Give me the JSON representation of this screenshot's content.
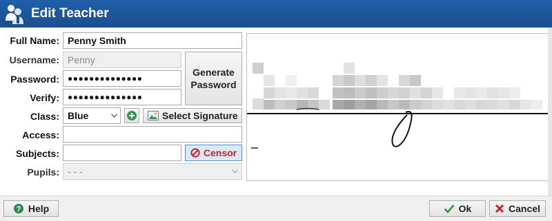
{
  "window": {
    "title": "Edit Teacher"
  },
  "form": {
    "full_name": {
      "label": "Full Name:",
      "value": "Penny Smith"
    },
    "username": {
      "label": "Username:",
      "value": "Penny"
    },
    "password": {
      "label": "Password:",
      "value": "●●●●●●●●●●●●●●"
    },
    "verify": {
      "label": "Verify:",
      "value": "●●●●●●●●●●●●●●"
    },
    "generate_password": {
      "line1": "Generate",
      "line2": "Password"
    },
    "class": {
      "label": "Class:",
      "value": "Blue"
    },
    "select_signature": {
      "label": "Select Signature"
    },
    "access": {
      "label": "Access:",
      "value": ""
    },
    "subjects": {
      "label": "Subjects:",
      "value": ""
    },
    "censor": {
      "label": "Censor"
    },
    "pupils": {
      "label": "Pupils:",
      "value": "- - -"
    }
  },
  "footer": {
    "help_label": "Help",
    "ok_label": "Ok",
    "cancel_label": "Cancel"
  },
  "colors": {
    "title_bar": "#1b5394",
    "censor_bg": "#dbe9f7",
    "censor_red": "#cc2222",
    "ok_green": "#2e9b2e",
    "cancel_red": "#cc1f1f",
    "add_green": "#2e9b4e"
  }
}
